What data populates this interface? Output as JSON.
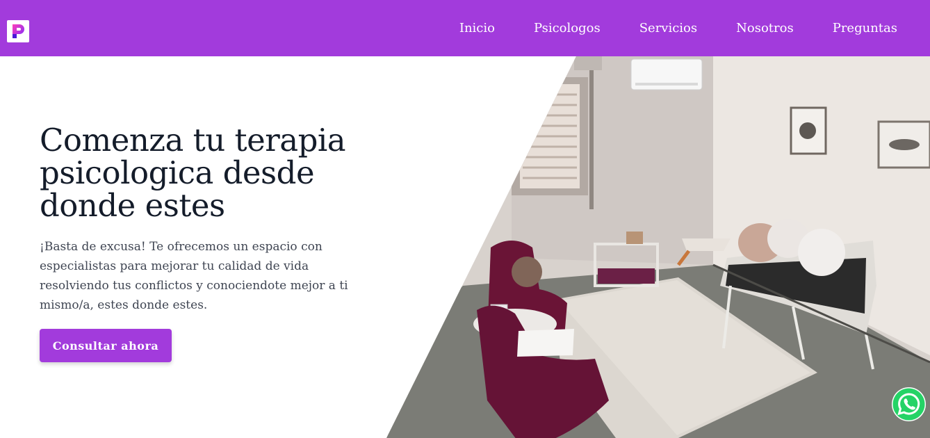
{
  "navbar": {
    "logo_icon": "brand-logo-icon",
    "links": [
      {
        "label": "Inicio"
      },
      {
        "label": "Psicologos"
      },
      {
        "label": "Servicios"
      },
      {
        "label": "Nosotros"
      },
      {
        "label": "Preguntas"
      }
    ]
  },
  "hero": {
    "title": "Comenza tu terapia psicologica desde donde estes",
    "description": "¡Basta de excusa! Te ofrecemos un espacio con especialistas para mejorar tu calidad de vida resolviendo tus conflictos y conociendote mejor a ti mismo/a, estes donde estes.",
    "cta_label": "Consultar ahora",
    "image_icon": "therapy-room-photo"
  },
  "whatsapp": {
    "icon": "whatsapp-icon"
  },
  "colors": {
    "brand": "#a23bdc",
    "text_dark": "#141c2a",
    "text_body": "#3f4552",
    "whatsapp": "#25d366"
  }
}
